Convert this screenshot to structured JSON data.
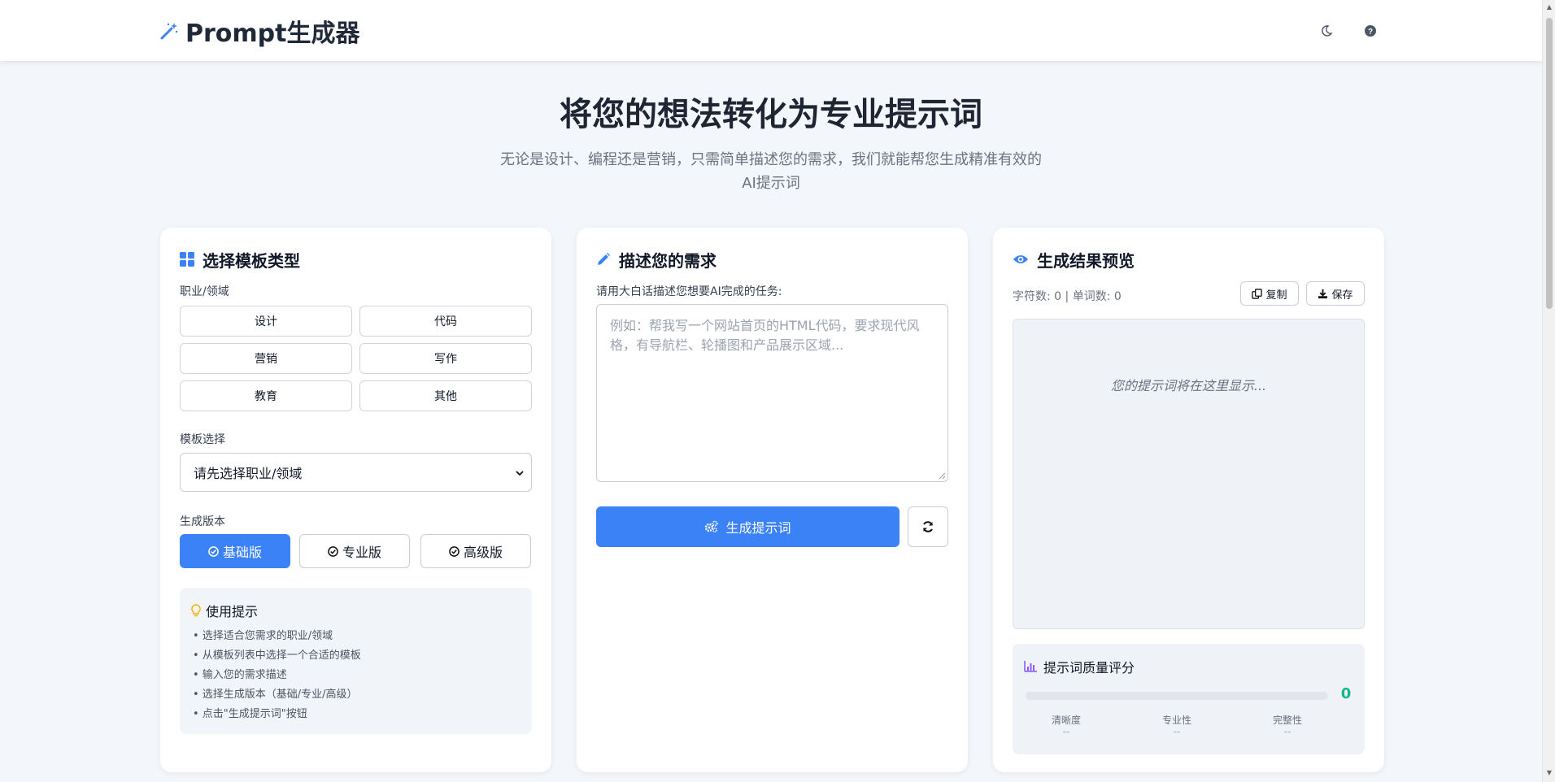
{
  "header": {
    "title": "Prompt生成器",
    "theme_icon": "moon-icon",
    "help_icon": "question-circle-icon"
  },
  "hero": {
    "title": "将您的想法转化为专业提示词",
    "subtitle_line1": "无论是设计、编程还是营销，只需简单描述您的需求，我们就能帮您生成精准有效的",
    "subtitle_line2": "AI提示词"
  },
  "template_card": {
    "title": "选择模板类型",
    "domain_label": "职业/领域",
    "domains": [
      "设计",
      "代码",
      "营销",
      "写作",
      "教育",
      "其他"
    ],
    "template_label": "模板选择",
    "template_select_value": "请先选择职业/领域",
    "version_label": "生成版本",
    "versions": [
      "基础版",
      "专业版",
      "高级版"
    ],
    "active_version": "基础版",
    "tips": {
      "title": "使用提示",
      "items": [
        "• 选择适合您需求的职业/领域",
        "• 从模板列表中选择一个合适的模板",
        "• 输入您的需求描述",
        "• 选择生成版本（基础/专业/高级）",
        "• 点击\"生成提示词\"按钮"
      ]
    }
  },
  "describe_card": {
    "title": "描述您的需求",
    "input_label": "请用大白话描述您想要AI完成的任务:",
    "placeholder": "例如：帮我写一个网站首页的HTML代码，要求现代风格，有导航栏、轮播图和产品展示区域...",
    "generate_label": "生成提示词"
  },
  "result_card": {
    "title": "生成结果预览",
    "counts": "字符数: 0 | 单词数: 0",
    "copy_label": "复制",
    "save_label": "保存",
    "preview_placeholder": "您的提示词将在这里显示...",
    "quality": {
      "title": "提示词质量评分",
      "score": "0",
      "score_fraction": 0,
      "metrics": [
        {
          "name": "清晰度",
          "value": "--"
        },
        {
          "name": "专业性",
          "value": "--"
        },
        {
          "name": "完整性",
          "value": "--"
        }
      ]
    }
  },
  "colors": {
    "accent": "#3b82f6",
    "score": "#10b981",
    "tip_icon": "#f5b301",
    "chart_icon": "#8b5cf6"
  }
}
